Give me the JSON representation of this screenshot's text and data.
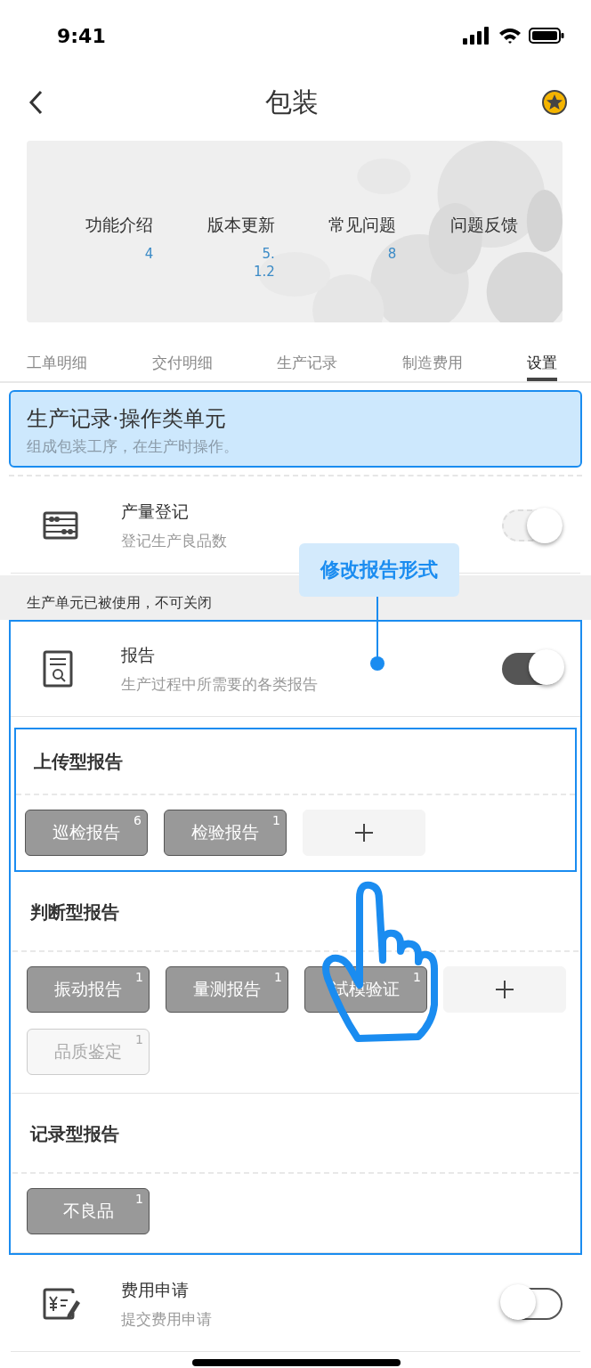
{
  "status_bar": {
    "time": "9:41"
  },
  "nav": {
    "title": "包装"
  },
  "banner": {
    "items": [
      {
        "label": "功能介绍",
        "count": "4"
      },
      {
        "label": "版本更新",
        "count": "5.1.2"
      },
      {
        "label": "常见问题",
        "count": "8"
      },
      {
        "label": "问题反馈"
      }
    ]
  },
  "tabs": [
    {
      "label": "工单明细",
      "selected": false
    },
    {
      "label": "交付明细",
      "selected": false
    },
    {
      "label": "生产记录",
      "selected": false
    },
    {
      "label": "制造费用",
      "selected": false
    },
    {
      "label": "设置",
      "selected": true
    }
  ],
  "section": {
    "title": "生产记录·操作类单元",
    "subtitle": "组成包装工序，在生产时操作。"
  },
  "units": [
    {
      "kind": "output",
      "name": "产量登记",
      "desc": "登记生产良品数",
      "on": true,
      "disabled": true
    },
    {
      "kind": "report",
      "name": "报告",
      "desc": "生产过程中所需要的各类报告",
      "on": true,
      "disabled": false,
      "notice": "生产单元已被使用，不可关闭",
      "highlighted": true,
      "groups": [
        {
          "title": "上传型报告",
          "highlighted": true,
          "can_add": true,
          "reports": [
            {
              "name": "巡检报告",
              "count": "6",
              "disabled": false
            },
            {
              "name": "检验报告",
              "count": "1",
              "disabled": false
            }
          ]
        },
        {
          "title": "判断型报告",
          "highlighted": false,
          "can_add": true,
          "reports": [
            {
              "name": "振动报告",
              "count": "1",
              "disabled": false
            },
            {
              "name": "量测报告",
              "count": "1",
              "disabled": false
            },
            {
              "name": "试模验证",
              "count": "1",
              "disabled": false
            },
            {
              "name": "品质鉴定",
              "count": "1",
              "disabled": true
            }
          ]
        },
        {
          "title": "记录型报告",
          "highlighted": false,
          "can_add": false,
          "reports": [
            {
              "name": "不良品",
              "count": "1",
              "disabled": false
            }
          ]
        }
      ]
    },
    {
      "kind": "expense",
      "name": "费用申请",
      "desc": "提交费用申请",
      "on": false,
      "disabled": false
    }
  ],
  "callout": {
    "text": "修改报告形式"
  }
}
